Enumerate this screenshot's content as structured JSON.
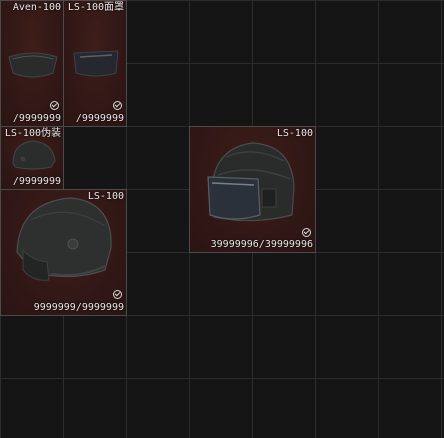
{
  "inventory": {
    "items": [
      {
        "name": "Aven-100",
        "durability": "/9999999"
      },
      {
        "name": "LS-100面罩",
        "durability": "/9999999"
      },
      {
        "name": "LS-100伪装",
        "durability": "/9999999"
      },
      {
        "name": "LS-100",
        "durability": "39999996/39999996"
      },
      {
        "name": "LS-100",
        "durability": "9999999/9999999"
      }
    ]
  }
}
